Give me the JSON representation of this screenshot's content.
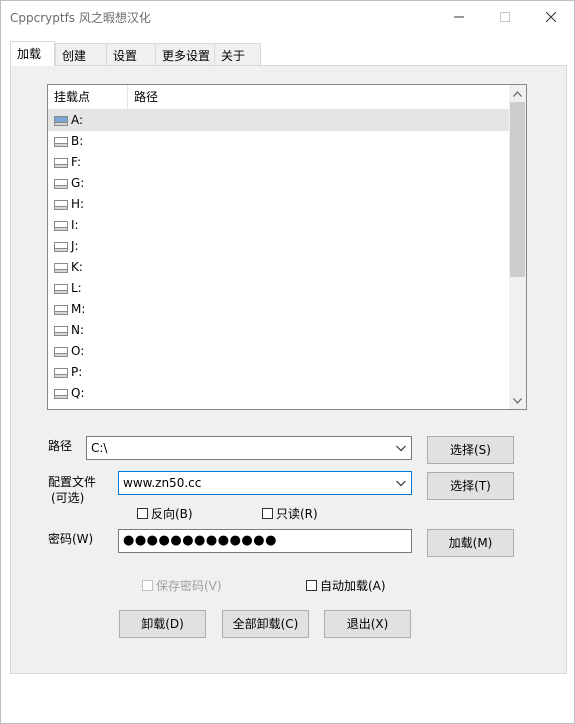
{
  "window": {
    "title": "Cppcryptfs 风之暇想汉化"
  },
  "tabs": [
    {
      "label": "加载"
    },
    {
      "label": "创建"
    },
    {
      "label": "设置"
    },
    {
      "label": "更多设置"
    },
    {
      "label": "关于"
    }
  ],
  "drive_list": {
    "columns": [
      "挂载点",
      "路径"
    ],
    "rows": [
      {
        "drive": "A:",
        "path": ""
      },
      {
        "drive": "B:",
        "path": ""
      },
      {
        "drive": "F:",
        "path": ""
      },
      {
        "drive": "G:",
        "path": ""
      },
      {
        "drive": "H:",
        "path": ""
      },
      {
        "drive": "I:",
        "path": ""
      },
      {
        "drive": "J:",
        "path": ""
      },
      {
        "drive": "K:",
        "path": ""
      },
      {
        "drive": "L:",
        "path": ""
      },
      {
        "drive": "M:",
        "path": ""
      },
      {
        "drive": "N:",
        "path": ""
      },
      {
        "drive": "O:",
        "path": ""
      },
      {
        "drive": "P:",
        "path": ""
      },
      {
        "drive": "Q:",
        "path": ""
      }
    ],
    "selected_index": 0
  },
  "form": {
    "path_label": "路径",
    "path_value": "C:\\",
    "path_select": "选择(S)",
    "config_label_line1": "配置文件",
    "config_label_line2": "(可选)",
    "config_value": "www.zn50.cc",
    "config_select": "选择(T)",
    "reverse_label": "反向(B)",
    "readonly_label": "只读(R)",
    "password_label": "密码(W)",
    "password_mask": "●●●●●●●●●●●●●",
    "mount_button": "加载(M)",
    "save_password_label": "保存密码(V)",
    "auto_mount_label": "自动加载(A)"
  },
  "actions": {
    "unmount": "卸载(D)",
    "unmount_all": "全部卸载(C)",
    "exit": "退出(X)"
  },
  "colors": {
    "focus_border": "#0078d7",
    "selected_row": "#e5e5e5",
    "drive_icon_selected": "#7aa7d6"
  }
}
